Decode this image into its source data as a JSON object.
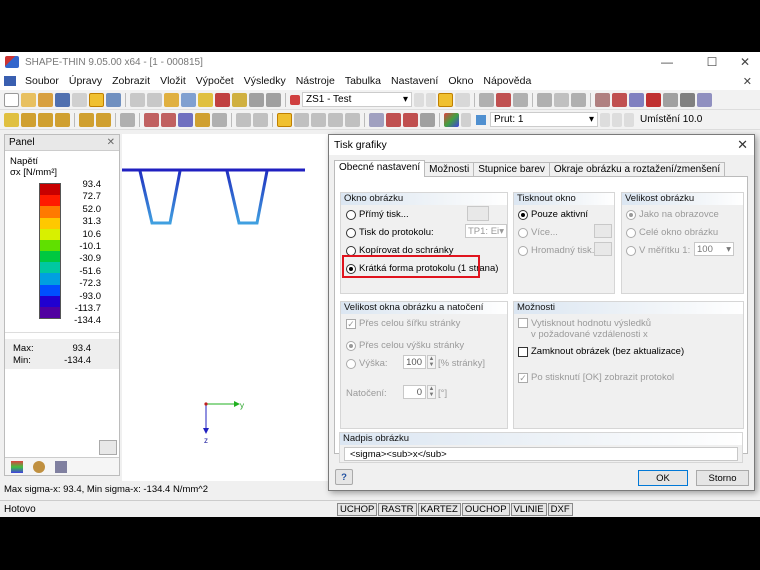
{
  "window": {
    "title": "SHAPE-THIN 9.05.00 x64 - [1 - 000815]",
    "minimize": "—",
    "maximize": "☐",
    "close": "✕"
  },
  "menu": [
    "Soubor",
    "Úpravy",
    "Zobrazit",
    "Vložit",
    "Výpočet",
    "Výsledky",
    "Nástroje",
    "Tabulka",
    "Nastavení",
    "Okno",
    "Nápověda"
  ],
  "mdi_close": "✕",
  "toolbar1": {
    "combo_value": "ZS1 - Test"
  },
  "toolbar2": {
    "combo_value": "Prut: 1",
    "location_label": "Umístění 10.0"
  },
  "panel": {
    "title": "Panel",
    "close": "✕",
    "quantity": "Napětí",
    "unit": "σx [N/mm²]",
    "legend_values": [
      "93.4",
      "72.7",
      "52.0",
      "31.3",
      "10.6",
      "-10.1",
      "-30.9",
      "-51.6",
      "-72.3",
      "-93.0",
      "-113.7",
      "-134.4"
    ],
    "legend_colors": [
      "#c80000",
      "#ff1a00",
      "#ff7a00",
      "#ffc800",
      "#d8f000",
      "#60e000",
      "#00c840",
      "#00c8a0",
      "#00a0e0",
      "#0050ff",
      "#2000d0",
      "#5000a0"
    ],
    "max_label": "Max:",
    "max_value": "93.4",
    "min_label": "Min:",
    "min_value": "-134.4"
  },
  "canvas": {
    "axis_y": "y",
    "axis_z": "z"
  },
  "status_line": "Max sigma-x: 93.4, Min sigma-x: -134.4 N/mm^2",
  "statusbar": {
    "ready": "Hotovo",
    "buttons": [
      "UCHOP",
      "RASTR",
      "KARTEZ",
      "OUCHOP",
      "VLINIE",
      "DXF"
    ]
  },
  "dialog": {
    "title": "Tisk grafiky",
    "close": "✕",
    "tabs": [
      "Obecné nastavení",
      "Možnosti",
      "Stupnice barev",
      "Okraje obrázku a roztažení/zmenšení"
    ],
    "okno_obrazku": {
      "title": "Okno obrázku",
      "options": [
        "Přímý tisk...",
        "Tisk do protokolu:",
        "Kopírovat do schránky",
        "Krátká forma protokolu (1 strana)"
      ],
      "protocol_combo": "TP1: Ei"
    },
    "tisknout_okno": {
      "title": "Tisknout okno",
      "options": [
        "Pouze aktivní",
        "Více...",
        "Hromadný tisk..."
      ]
    },
    "velikost_obrazku": {
      "title": "Velikost obrázku",
      "options": [
        "Jako na obrazovce",
        "Celé okno obrázku",
        "V měřítku 1:"
      ],
      "scale_value": "100"
    },
    "velikost_okna": {
      "title": "Velikost okna obrázku a natočení",
      "across_width": "Přes celou šířku stránky",
      "across_height": "Přes celou výšku stránky",
      "height_label": "Výška:",
      "height_value": "100",
      "height_unit": "[% stránky]",
      "rotation_label": "Natočení:",
      "rotation_value": "0",
      "rotation_unit": "[°]"
    },
    "moznosti": {
      "title": "Možnosti",
      "opt1_line1": "Vytisknout hodnotu výsledků",
      "opt1_line2": "v požadované vzdálenosti x",
      "opt2": "Zamknout obrázek (bez aktualizace)",
      "opt3": "Po stisknutí [OK] zobrazit protokol"
    },
    "nadpis": {
      "title": "Nadpis obrázku",
      "value": "<sigma><sub>x</sub>"
    },
    "help": "?",
    "ok": "OK",
    "cancel": "Storno"
  }
}
